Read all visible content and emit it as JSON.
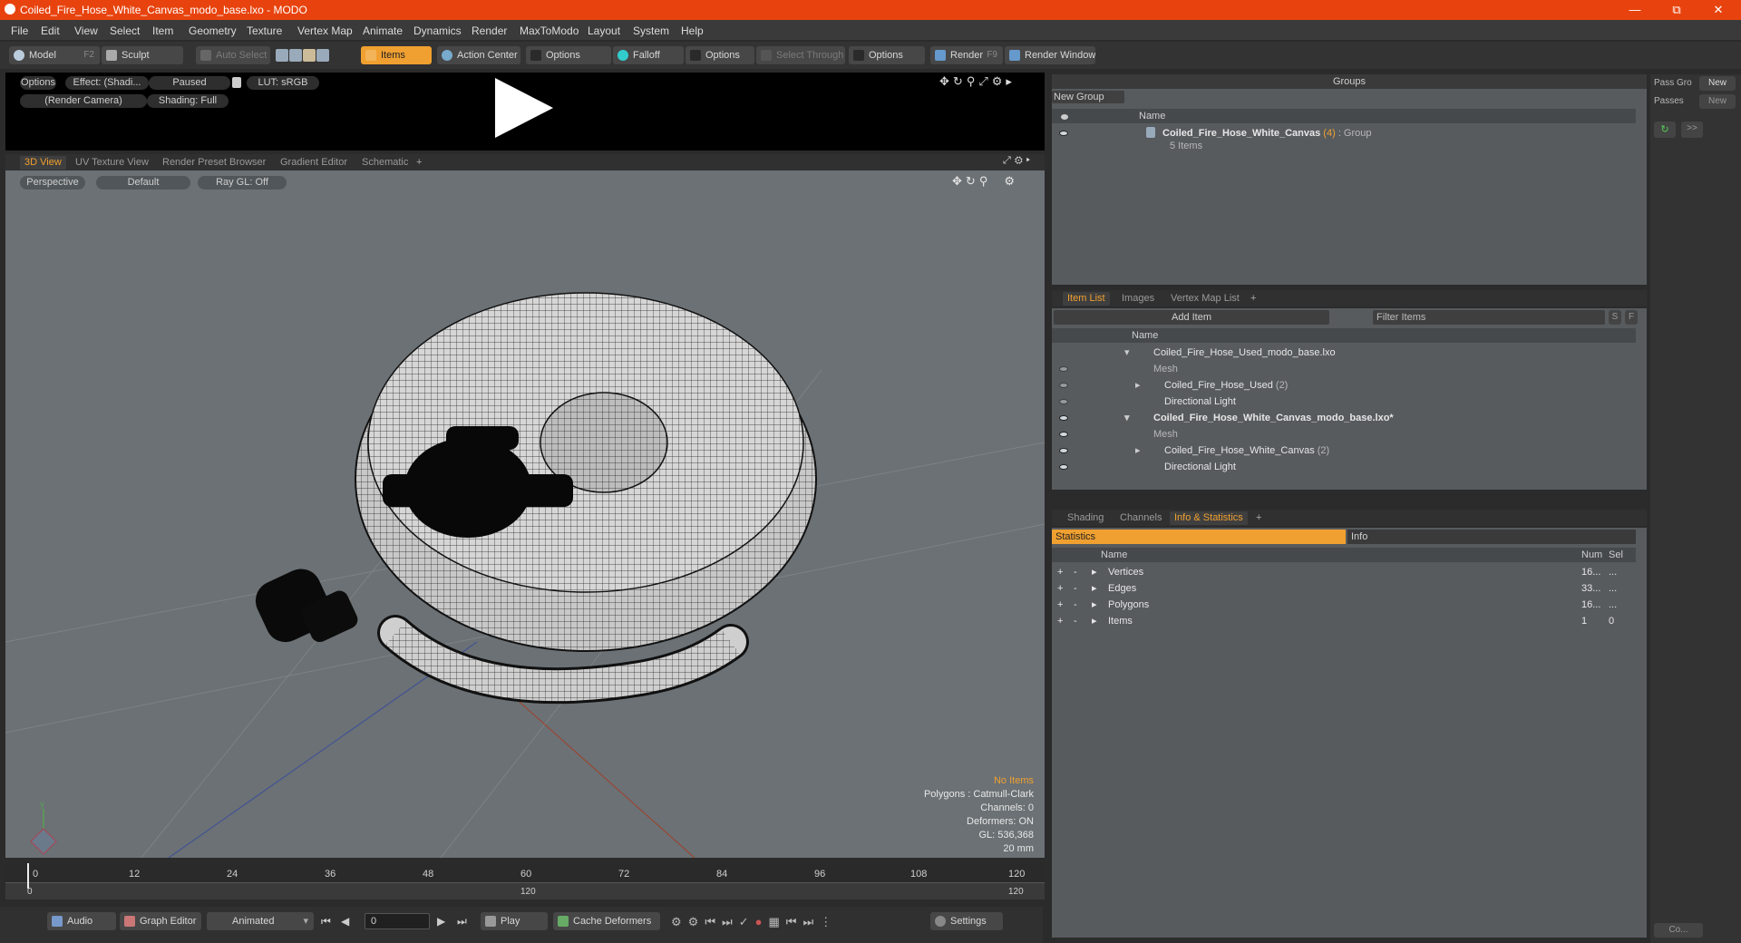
{
  "window": {
    "title": "Coiled_Fire_Hose_White_Canvas_modo_base.lxo - MODO"
  },
  "menu": [
    "File",
    "Edit",
    "View",
    "Select",
    "Item",
    "Geometry",
    "Texture",
    "Vertex Map",
    "Animate",
    "Dynamics",
    "Render",
    "MaxToModo",
    "Layout",
    "System",
    "Help"
  ],
  "toolbar": {
    "model": "Model",
    "model_key": "F2",
    "sculpt": "Sculpt",
    "auto_select": "Auto Select",
    "items": "Items",
    "action_center": "Action Center",
    "options1": "Options",
    "falloff": "Falloff",
    "options2": "Options",
    "select_through": "Select Through",
    "options3": "Options",
    "render": "Render",
    "render_key": "F9",
    "render_window": "Render Window"
  },
  "preview": {
    "options": "Options",
    "effect": "Effect: (Shadi...",
    "paused": "Paused",
    "lut": "LUT: sRGB",
    "camera": "(Render Camera)",
    "shading": "Shading: Full"
  },
  "viewtabs": [
    "3D View",
    "UV Texture View",
    "Render Preset Browser",
    "Gradient Editor",
    "Schematic"
  ],
  "viewport": {
    "perspective": "Perspective",
    "default": "Default",
    "raygl": "Ray GL: Off",
    "status": {
      "title": "No Items",
      "polygons": "Polygons : Catmull-Clark",
      "channels": "Channels: 0",
      "deformers": "Deformers: ON",
      "gl": "GL: 536,368",
      "scale": "20 mm"
    }
  },
  "timeline": {
    "ticks": [
      "0",
      "12",
      "24",
      "36",
      "48",
      "60",
      "72",
      "84",
      "96",
      "108",
      "120"
    ],
    "start": "0",
    "mid": "120",
    "end": "120"
  },
  "bottombar": {
    "audio": "Audio",
    "graph_editor": "Graph Editor",
    "animated": "Animated",
    "frame": "0",
    "play": "Play",
    "cache_deformers": "Cache Deformers",
    "settings": "Settings"
  },
  "groups": {
    "title": "Groups",
    "new_group": "New Group",
    "col_name": "Name",
    "row_name": "Coiled_Fire_Hose_White_Canvas",
    "row_count": "(4)",
    "row_type": ": Group",
    "row_items": "5 Items"
  },
  "passes": {
    "pass_group": "Pass Gro",
    "new1": "New",
    "passes": "Passes",
    "new2": "New",
    "more": ">>",
    "co": "Co..."
  },
  "itemlist": {
    "tabs": [
      "Item List",
      "Images",
      "Vertex Map List"
    ],
    "add_item": "Add Item",
    "filter": "Filter Items",
    "s": "S",
    "f": "F",
    "col_name": "Name",
    "rows": [
      {
        "label": "Coiled_Fire_Hose_Used_modo_base.lxo",
        "extra": ""
      },
      {
        "label": "Mesh",
        "extra": ""
      },
      {
        "label": "Coiled_Fire_Hose_Used",
        "extra": "(2)"
      },
      {
        "label": "Directional Light",
        "extra": ""
      },
      {
        "label": "Coiled_Fire_Hose_White_Canvas_modo_base.lxo*",
        "extra": ""
      },
      {
        "label": "Mesh",
        "extra": ""
      },
      {
        "label": "Coiled_Fire_Hose_White_Canvas",
        "extra": "(2)"
      },
      {
        "label": "Directional Light",
        "extra": ""
      }
    ]
  },
  "stats": {
    "tabs": [
      "Shading",
      "Channels",
      "Info & Statistics"
    ],
    "statistics": "Statistics",
    "info": "Info",
    "col_name": "Name",
    "col_num": "Num",
    "col_sel": "Sel",
    "rows": [
      {
        "name": "Vertices",
        "num": "16...",
        "sel": "..."
      },
      {
        "name": "Edges",
        "num": "33...",
        "sel": "..."
      },
      {
        "name": "Polygons",
        "num": "16...",
        "sel": "..."
      },
      {
        "name": "Items",
        "num": "1",
        "sel": "0"
      }
    ]
  },
  "colors": {
    "accent": "#f0a030",
    "titlebar": "#e8430e"
  }
}
